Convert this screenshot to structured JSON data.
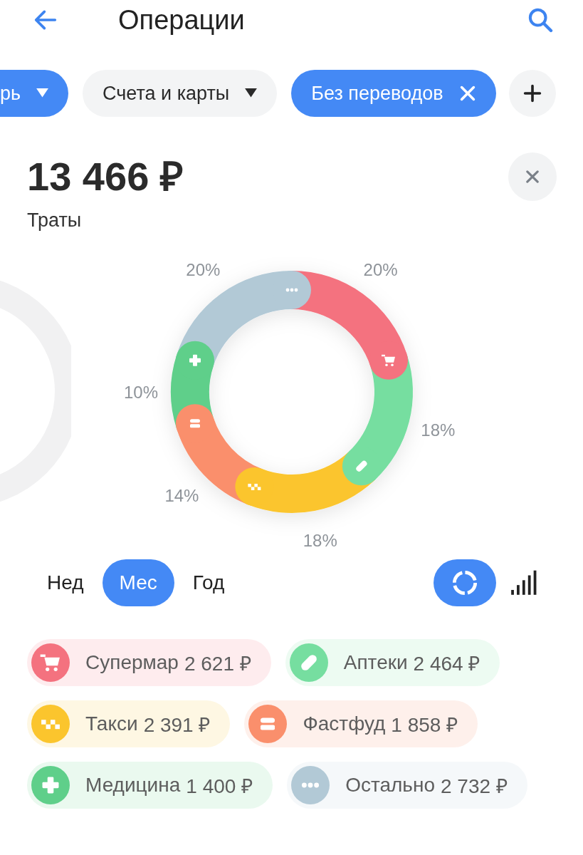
{
  "header": {
    "title": "Операции"
  },
  "filters": [
    {
      "label": "рь",
      "kind": "dropdown",
      "active": true
    },
    {
      "label": "Счета и карты",
      "kind": "dropdown",
      "active": false
    },
    {
      "label": "Без переводов",
      "kind": "removable",
      "active": true
    }
  ],
  "summary": {
    "amount": "13 466 ₽",
    "caption": "Траты"
  },
  "chart_data": {
    "type": "donut",
    "values": [
      20,
      18,
      18,
      14,
      10,
      20
    ],
    "value_labels": [
      "20%",
      "18%",
      "18%",
      "14%",
      "10%",
      "20%"
    ]
  },
  "periods": [
    {
      "label": "Нед",
      "selected": false
    },
    {
      "label": "Мес",
      "selected": true
    },
    {
      "label": "Год",
      "selected": false
    }
  ],
  "views": [
    {
      "kind": "donut",
      "selected": true
    },
    {
      "kind": "bars",
      "selected": false
    }
  ],
  "legend": [
    [
      {
        "name": "Супермар",
        "amount": "2 621 ₽",
        "color": "#f4727f",
        "kind": "cart"
      },
      {
        "name": "Аптеки",
        "amount": "2 464 ₽",
        "color": "#76dea0",
        "kind": "pill"
      }
    ],
    [
      {
        "name": "Такси",
        "amount": "2 391 ₽",
        "color": "#fbc52d",
        "kind": "taxi"
      },
      {
        "name": "Фастфуд",
        "amount": "1 858 ₽",
        "color": "#fa8f6c",
        "kind": "burger"
      }
    ],
    [
      {
        "name": "Медицина",
        "amount": "1 400 ₽",
        "color": "#5fcf8a",
        "kind": "cross"
      },
      {
        "name": "Остально",
        "amount": "2 732 ₽",
        "color": "#b2c9d6",
        "kind": "dots"
      }
    ]
  ]
}
